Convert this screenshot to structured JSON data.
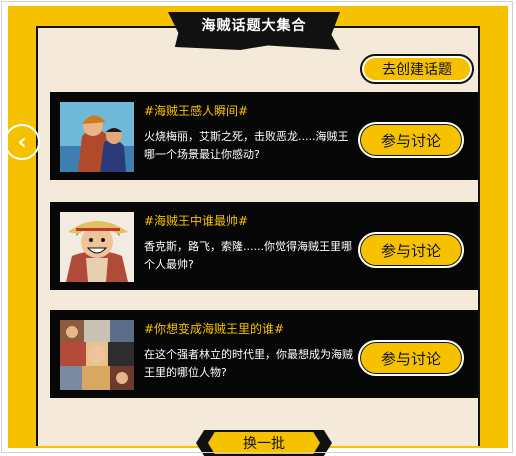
{
  "header": {
    "title": "海贼话题大集合"
  },
  "toolbar": {
    "create_label": "去创建话题"
  },
  "topics": [
    {
      "tag": "#海贼王感人瞬间#",
      "desc": "火烧梅丽，艾斯之死，击败恶龙.....海贼王哪一个场景最让你感动?",
      "button": "参与讨论",
      "thumb": "ace-luffy-image"
    },
    {
      "tag": "#海贼王中谁最帅#",
      "desc": "香克斯，路飞，索隆......你觉得海贼王里哪个人最帅?",
      "button": "参与讨论",
      "thumb": "luffy-image"
    },
    {
      "tag": "#你想变成海贼王里的谁#",
      "desc": "在这个强者林立的时代里，你最想成为海贼王里的哪位人物?",
      "button": "参与讨论",
      "thumb": "crew-collage-image"
    }
  ],
  "footer": {
    "refresh_label": "换一批"
  },
  "nav": {
    "prev_icon": "chevron-left-icon"
  },
  "colors": {
    "accent": "#f6c200",
    "card_bg": "#070707",
    "panel_bg": "#f5ead9"
  }
}
